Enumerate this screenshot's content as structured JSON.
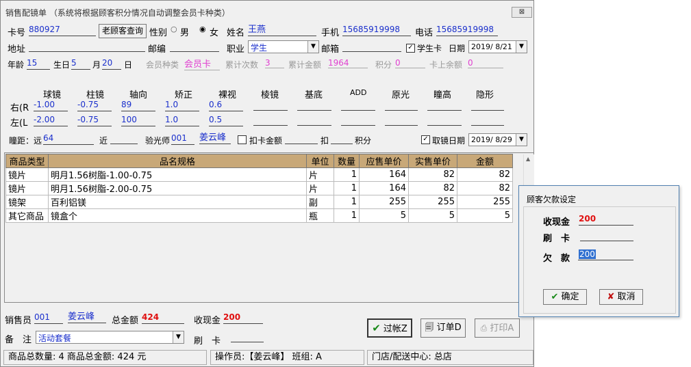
{
  "window": {
    "title": "销售配镜单 （系统将根据顾客积分情况自动调整会员卡种类）",
    "close": "⊠"
  },
  "customer": {
    "card_label": "卡号",
    "card_no": "880927",
    "old_customer_btn": "老顾客查询",
    "gender_label": "性别",
    "gender_male": "男",
    "gender_female": "女",
    "name_label": "姓名",
    "name": "王燕",
    "mobile_label": "手机",
    "mobile": "15685919998",
    "phone_label": "电话",
    "phone": "15685919998",
    "address_label": "地址",
    "zip_label": "邮编",
    "job_label": "职业",
    "job": "学生",
    "email_label": "邮箱",
    "student_card_label": "学生卡",
    "date_label": "日期",
    "date": "2019/ 8/21",
    "age_label": "年龄",
    "age": "15",
    "birth_label": "生日",
    "birth_month": "5",
    "month_label": "月",
    "birth_day": "20",
    "day_label": "日",
    "member_type_label": "会员种类",
    "member_type": "会员卡",
    "visit_count_label": "累计次数",
    "visit_count": "3",
    "total_amount_label": "累计金额",
    "total_amount": "1964",
    "points_label": "积分",
    "points": "0",
    "card_balance_label": "卡上余额",
    "card_balance": "0"
  },
  "prescription": {
    "headers": [
      "球镜",
      "柱镜",
      "轴向",
      "矫正",
      "裸视",
      "棱镜",
      "基底",
      "ADD",
      "原光",
      "瞳高",
      "隐形"
    ],
    "right_label": "右(R",
    "left_label": "左(L",
    "right": [
      "-1.00",
      "-0.75",
      "89",
      "1.0",
      "0.6"
    ],
    "left": [
      "-2.00",
      "-0.75",
      "100",
      "1.0",
      "0.5"
    ],
    "pd_label": "瞳距：远",
    "pd_far": "64",
    "near_label": "近",
    "optometrist_label": "验光师",
    "optometrist_code": "001",
    "optometrist_name": "姜云峰",
    "deduct_card_label": "扣卡金额",
    "deduct_label": "扣",
    "points_label": "积分",
    "pickup_label": "取镜日期",
    "pickup_date": "2019/ 8/29"
  },
  "items": {
    "headers": [
      "商品类型",
      "品名规格",
      "单位",
      "数量",
      "应售单价",
      "实售单价",
      "金额"
    ],
    "rows": [
      [
        "镜片",
        "明月1.56树脂-1.00-0.75",
        "片",
        "1",
        "164",
        "82",
        "82"
      ],
      [
        "镜片",
        "明月1.56树脂-2.00-0.75",
        "片",
        "1",
        "164",
        "82",
        "82"
      ],
      [
        "镜架",
        "百利铝镁",
        "副",
        "1",
        "255",
        "255",
        "255"
      ],
      [
        "其它商品",
        "镜盒个",
        "瓶",
        "1",
        "5",
        "5",
        "5"
      ]
    ]
  },
  "footer": {
    "seller_label": "销售员",
    "seller_code": "001",
    "seller_name": "姜云峰",
    "total_label": "总金额",
    "total": "424",
    "cash_label": "收现金",
    "cash": "200",
    "note_label": "备　注",
    "note": "活动套餐",
    "card_label": "刷　卡",
    "post_btn": "过帐Z",
    "order_btn": "订单D",
    "print_btn": "打印A"
  },
  "status": {
    "summary": "商品总数量: 4 商品总金额: 424 元",
    "operator": "操作员:【姜云峰】 班组: A",
    "store": "门店/配送中心: 总店"
  },
  "dialog": {
    "title": "顾客欠款设定",
    "cash_label": "收现金",
    "cash": "200",
    "card_label": "刷　卡",
    "debt_label": "欠　款",
    "debt": "200",
    "ok": "确定",
    "cancel": "取消"
  }
}
